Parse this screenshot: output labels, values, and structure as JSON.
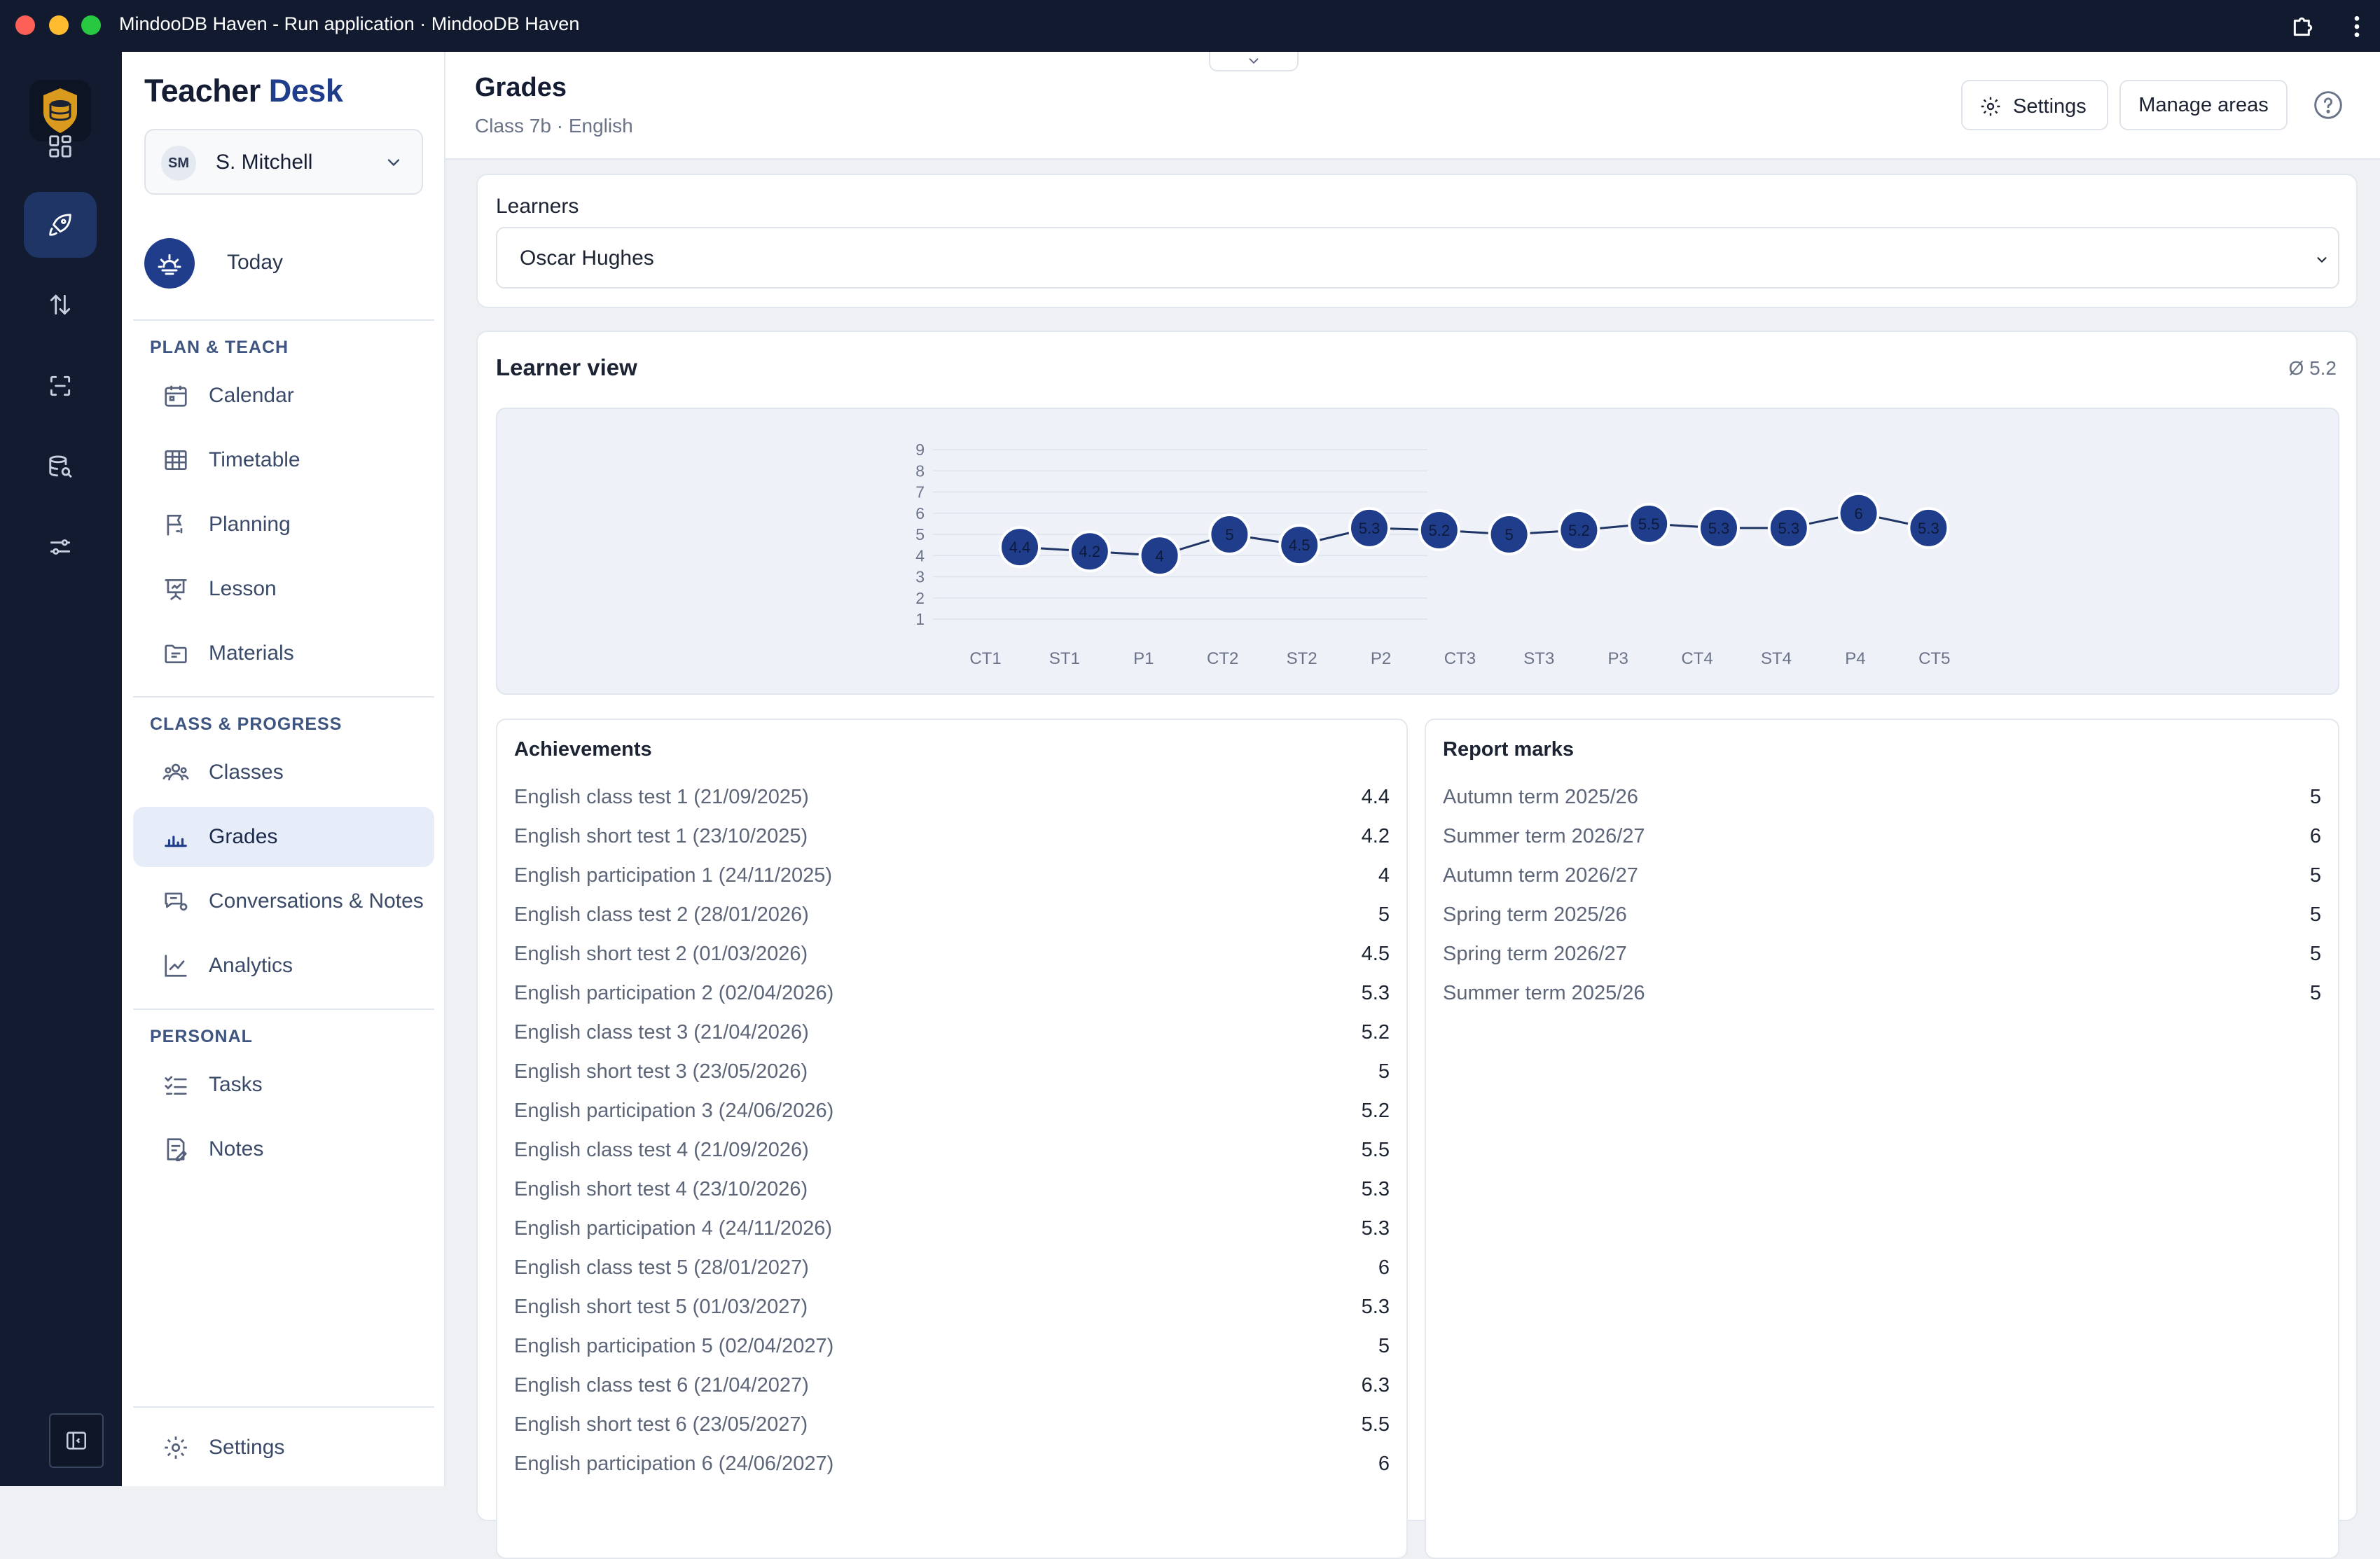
{
  "window": {
    "title": "MindooDB Haven - Run application · MindooDB Haven"
  },
  "icons": {
    "extension": "puzzle-icon",
    "more": "more-vertical-icon",
    "rail": [
      "dashboard-icon",
      "rocket-icon",
      "sort-arrows-icon",
      "scan-icon",
      "database-search-icon",
      "sliders-icon"
    ],
    "collapse": "sidebar-toggle-icon"
  },
  "sidebar": {
    "brand_part1": "Teacher",
    "brand_part2": "Desk",
    "user": {
      "initials": "SM",
      "name": "S. Mitchell"
    },
    "today": "Today",
    "sections": {
      "plan": "PLAN & TEACH",
      "class": "CLASS & PROGRESS",
      "personal": "PERSONAL"
    },
    "items": {
      "calendar": "Calendar",
      "timetable": "Timetable",
      "planning": "Planning",
      "lesson": "Lesson",
      "materials": "Materials",
      "classes": "Classes",
      "grades": "Grades",
      "conversations": "Conversations & Notes",
      "analytics": "Analytics",
      "tasks": "Tasks",
      "notes": "Notes",
      "settings": "Settings"
    },
    "active": "Grades"
  },
  "header": {
    "title": "Grades",
    "subtitle": "Class 7b · English",
    "settings_label": "Settings",
    "manage_label": "Manage areas"
  },
  "learners": {
    "label": "Learners",
    "selected": "Oscar Hughes"
  },
  "learner_view": {
    "title": "Learner view",
    "average": "Ø 5.2"
  },
  "chart_data": {
    "type": "line",
    "title": "",
    "xlabel": "",
    "ylabel": "",
    "ylim": [
      1,
      9
    ],
    "y_ticks": [
      1,
      2,
      3,
      4,
      5,
      6,
      7,
      8,
      9
    ],
    "x_tick_labels": [
      "CT1",
      "ST1",
      "P1",
      "CT2",
      "ST2",
      "P2",
      "CT3",
      "ST3",
      "P3",
      "CT4",
      "ST4",
      "P4",
      "CT5"
    ],
    "series": [
      {
        "values": [
          4.4,
          4.2,
          4,
          5,
          4.5,
          5.3,
          5.2,
          5,
          5.2,
          5.5,
          5.3,
          5.3,
          6,
          5.3
        ]
      }
    ],
    "grid": true,
    "colors": {
      "line": "#1f3566",
      "point": "#1f3d8a"
    }
  },
  "achievements": {
    "title": "Achievements",
    "rows": [
      {
        "label": "English class test 1 (21/09/2025)",
        "value": "4.4"
      },
      {
        "label": "English short test 1 (23/10/2025)",
        "value": "4.2"
      },
      {
        "label": "English participation 1 (24/11/2025)",
        "value": "4"
      },
      {
        "label": "English class test 2 (28/01/2026)",
        "value": "5"
      },
      {
        "label": "English short test 2 (01/03/2026)",
        "value": "4.5"
      },
      {
        "label": "English participation 2 (02/04/2026)",
        "value": "5.3"
      },
      {
        "label": "English class test 3 (21/04/2026)",
        "value": "5.2"
      },
      {
        "label": "English short test 3 (23/05/2026)",
        "value": "5"
      },
      {
        "label": "English participation 3 (24/06/2026)",
        "value": "5.2"
      },
      {
        "label": "English class test 4 (21/09/2026)",
        "value": "5.5"
      },
      {
        "label": "English short test 4 (23/10/2026)",
        "value": "5.3"
      },
      {
        "label": "English participation 4 (24/11/2026)",
        "value": "5.3"
      },
      {
        "label": "English class test 5 (28/01/2027)",
        "value": "6"
      },
      {
        "label": "English short test 5 (01/03/2027)",
        "value": "5.3"
      },
      {
        "label": "English participation 5 (02/04/2027)",
        "value": "5"
      },
      {
        "label": "English class test 6 (21/04/2027)",
        "value": "6.3"
      },
      {
        "label": "English short test 6 (23/05/2027)",
        "value": "5.5"
      },
      {
        "label": "English participation 6 (24/06/2027)",
        "value": "6"
      }
    ]
  },
  "report_marks": {
    "title": "Report marks",
    "rows": [
      {
        "label": "Autumn term 2025/26",
        "value": "5"
      },
      {
        "label": "Summer term 2026/27",
        "value": "6"
      },
      {
        "label": "Autumn term 2026/27",
        "value": "5"
      },
      {
        "label": "Spring term 2025/26",
        "value": "5"
      },
      {
        "label": "Spring term 2026/27",
        "value": "5"
      },
      {
        "label": "Summer term 2025/26",
        "value": "5"
      }
    ]
  }
}
